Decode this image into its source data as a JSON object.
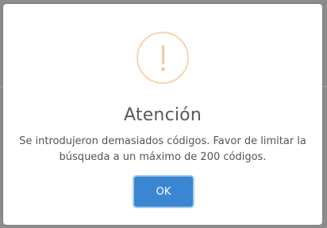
{
  "dialog": {
    "icon": "exclamation-icon",
    "title": "Atención",
    "message": "Se introdujeron demasiados códigos. Favor de limitar la búsqueda a un máximo de 200 códigos.",
    "confirm_label": "OK"
  },
  "colors": {
    "accent": "#3b86d3",
    "warning": "#f7c59f",
    "backdrop": "#8c8c8c"
  }
}
